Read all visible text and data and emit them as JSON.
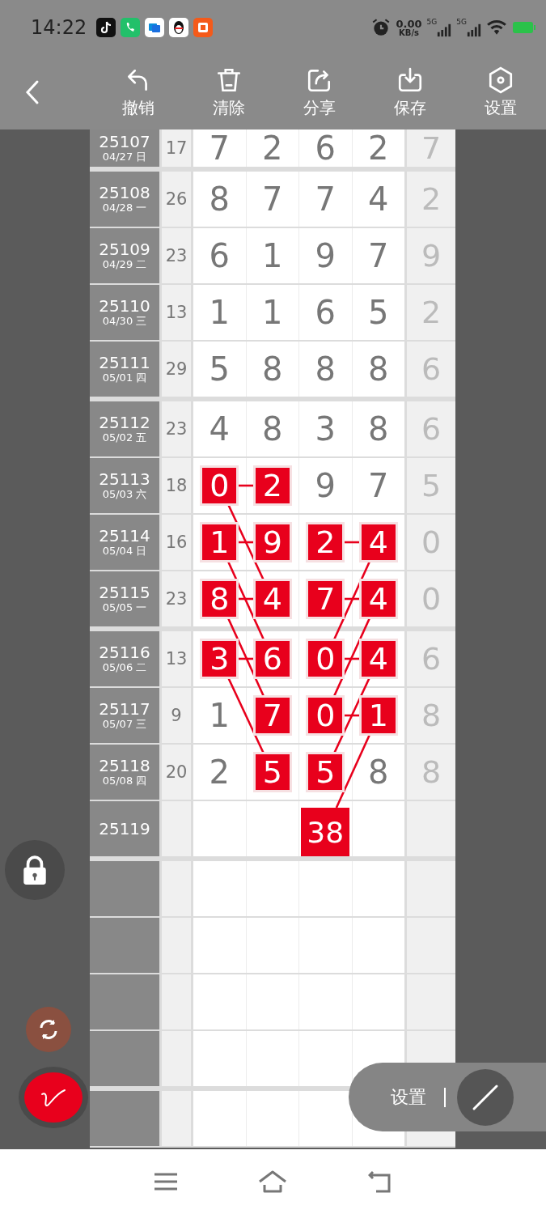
{
  "status_bar": {
    "time": "14:22",
    "net_speed": "0.00",
    "net_unit": "KB/s",
    "signals": [
      {
        "label": "5G"
      },
      {
        "label": "5G"
      }
    ]
  },
  "toolbar": {
    "items": [
      {
        "label": "撤销",
        "kind": "undo"
      },
      {
        "label": "清除",
        "kind": "clear"
      },
      {
        "label": "分享",
        "kind": "share"
      },
      {
        "label": "保存",
        "kind": "save"
      },
      {
        "label": "设置",
        "kind": "settings"
      }
    ]
  },
  "rows": [
    {
      "period": "25107",
      "date": "04/27 日",
      "sum": "17",
      "last": "7",
      "cells": [
        {
          "value": "7",
          "marked": false
        },
        {
          "value": "2",
          "marked": false
        },
        {
          "value": "6",
          "marked": false
        },
        {
          "value": "2",
          "marked": false
        }
      ]
    },
    {
      "period": "25108",
      "date": "04/28 一",
      "sum": "26",
      "last": "2",
      "cells": [
        {
          "value": "8",
          "marked": false
        },
        {
          "value": "7",
          "marked": false
        },
        {
          "value": "7",
          "marked": false
        },
        {
          "value": "4",
          "marked": false
        }
      ]
    },
    {
      "period": "25109",
      "date": "04/29 二",
      "sum": "23",
      "last": "9",
      "cells": [
        {
          "value": "6",
          "marked": false
        },
        {
          "value": "1",
          "marked": false
        },
        {
          "value": "9",
          "marked": false
        },
        {
          "value": "7",
          "marked": false
        }
      ]
    },
    {
      "period": "25110",
      "date": "04/30 三",
      "sum": "13",
      "last": "2",
      "cells": [
        {
          "value": "1",
          "marked": false
        },
        {
          "value": "1",
          "marked": false
        },
        {
          "value": "6",
          "marked": false
        },
        {
          "value": "5",
          "marked": false
        }
      ]
    },
    {
      "period": "25111",
      "date": "05/01 四",
      "sum": "29",
      "last": "6",
      "cells": [
        {
          "value": "5",
          "marked": false
        },
        {
          "value": "8",
          "marked": false
        },
        {
          "value": "8",
          "marked": false
        },
        {
          "value": "8",
          "marked": false
        }
      ]
    },
    {
      "period": "25112",
      "date": "05/02 五",
      "sum": "23",
      "last": "6",
      "cells": [
        {
          "value": "4",
          "marked": false
        },
        {
          "value": "8",
          "marked": false
        },
        {
          "value": "3",
          "marked": false
        },
        {
          "value": "8",
          "marked": false
        }
      ]
    },
    {
      "period": "25113",
      "date": "05/03 六",
      "sum": "18",
      "last": "5",
      "cells": [
        {
          "value": "0",
          "marked": true,
          "join": true,
          "down_right": true
        },
        {
          "value": "2",
          "marked": true
        },
        {
          "value": "9",
          "marked": false
        },
        {
          "value": "7",
          "marked": false
        }
      ]
    },
    {
      "period": "25114",
      "date": "05/04 日",
      "sum": "16",
      "last": "0",
      "cells": [
        {
          "value": "1",
          "marked": true,
          "join": true,
          "down_right": true
        },
        {
          "value": "9",
          "marked": true
        },
        {
          "value": "2",
          "marked": true,
          "join": true
        },
        {
          "value": "4",
          "marked": true,
          "down_left": true
        }
      ]
    },
    {
      "period": "25115",
      "date": "05/05 一",
      "sum": "23",
      "last": "0",
      "cells": [
        {
          "value": "8",
          "marked": true,
          "join": true,
          "down_right": true
        },
        {
          "value": "4",
          "marked": true
        },
        {
          "value": "7",
          "marked": true,
          "join": true
        },
        {
          "value": "4",
          "marked": true,
          "down_left": true
        }
      ]
    },
    {
      "period": "25116",
      "date": "05/06 二",
      "sum": "13",
      "last": "6",
      "cells": [
        {
          "value": "3",
          "marked": true,
          "join": true,
          "down_right": true
        },
        {
          "value": "6",
          "marked": true
        },
        {
          "value": "0",
          "marked": true,
          "join": true
        },
        {
          "value": "4",
          "marked": true,
          "down_left": true
        }
      ]
    },
    {
      "period": "25117",
      "date": "05/07 三",
      "sum": "9",
      "last": "8",
      "cells": [
        {
          "value": "1",
          "marked": false
        },
        {
          "value": "7",
          "marked": true
        },
        {
          "value": "0",
          "marked": true,
          "join": true
        },
        {
          "value": "1",
          "marked": true,
          "down_left": true
        }
      ]
    },
    {
      "period": "25118",
      "date": "05/08 四",
      "sum": "20",
      "last": "8",
      "cells": [
        {
          "value": "2",
          "marked": false
        },
        {
          "value": "5",
          "marked": true
        },
        {
          "value": "5",
          "marked": true
        },
        {
          "value": "8",
          "marked": false
        }
      ]
    },
    {
      "period": "25119",
      "cells": [
        {
          "marked": false
        },
        {
          "marked": false
        },
        {
          "value": "38",
          "marked": true
        },
        {
          "marked": false
        }
      ]
    }
  ],
  "float_panel": {
    "label": "设置"
  }
}
